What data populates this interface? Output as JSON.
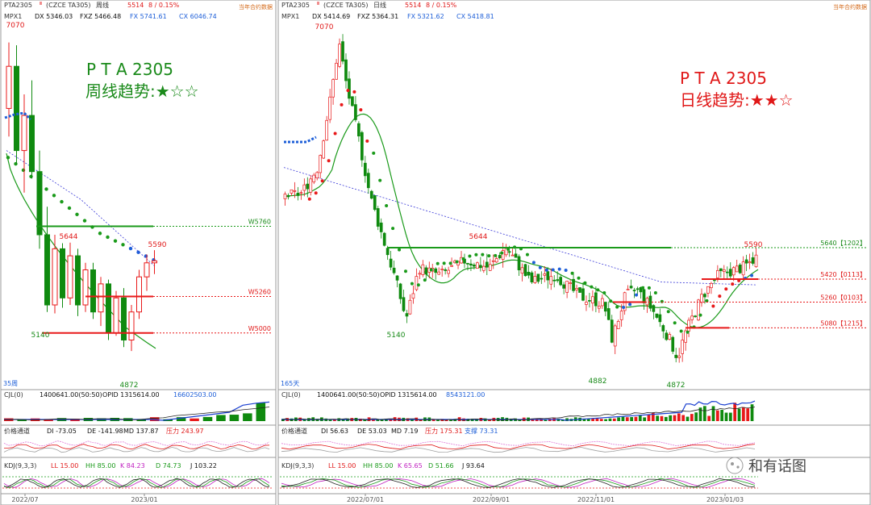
{
  "left": {
    "header": {
      "symbol": "PTA2305",
      "sup": "Ⅲ",
      "contract": "(CZCE TA305)",
      "period": "周线",
      "price": "5514",
      "change": "8 / 0.15%",
      "note": "当年合约数据"
    },
    "indicator_line": {
      "name": "MPX1",
      "dx": "DX 5346.03",
      "fxz": "FXZ 5466.48",
      "fx": "FX 5741.61",
      "cx": "CX 6046.74"
    },
    "watermark": {
      "line1": "P T A  2305",
      "line2": "周线趋势:★☆☆"
    },
    "bars_count_label": "35周",
    "cjl": {
      "name": "CJL(0)",
      "vol": "1400641.00(50:50)",
      "opid": "OPID 1315614.00",
      "extra": "16602503.00"
    },
    "channel": {
      "name": "价格通道",
      "di": "DI -73.05",
      "de": "DE -141.98",
      "md": "MD 137.87",
      "yl": "压力 243.97"
    },
    "kdj": {
      "name": "KDJ(9,3,3)",
      "ll": "LL 15.00",
      "hh": "HH 85.00",
      "k": "K 84.23",
      "d": "D 74.73",
      "j": "J 103.22"
    },
    "x_ticks": [
      "2022/07",
      "2023/01"
    ]
  },
  "right": {
    "header": {
      "symbol": "PTA2305",
      "sup": "Ⅲ",
      "contract": "(CZCE TA305)",
      "period": "日线",
      "price": "5514",
      "change": "8 / 0.15%",
      "note": "当年合约数据"
    },
    "indicator_line": {
      "name": "MPX1",
      "dx": "DX 5414.69",
      "fxz": "FXZ 5364.31",
      "fx": "FX 5321.62",
      "cx": "CX 5418.81"
    },
    "watermark": {
      "line1": "P T A  2305",
      "line2": "日线趋势:★★☆"
    },
    "bars_count_label": "165天",
    "cjl": {
      "name": "CJL(0)",
      "vol": "1400641.00(50:50)",
      "opid": "OPID 1315614.00",
      "extra": "8543121.00"
    },
    "channel": {
      "name": "价格通道",
      "di": "DI 56.63",
      "de": "DE 53.03",
      "md": "MD 7.19",
      "yl": "压力 175.31",
      "zc": "支撑 73.31"
    },
    "kdj": {
      "name": "KDJ(9,3,3)",
      "ll": "LL 15.00",
      "hh": "HH 85.00",
      "k": "K 65.65",
      "d": "D 51.66",
      "j": "J 93.64"
    },
    "x_ticks": [
      "2022/07/01",
      "2022/09/01",
      "2022/11/01",
      "2023/01/03"
    ]
  },
  "brand": {
    "name": "和有话图"
  },
  "colors": {
    "up": "#e8191a",
    "down": "#0f8a0f",
    "blue": "#1e5fd8",
    "green_line": "#1a9a1a",
    "red_line": "#e8191a",
    "label_green": "#188a18",
    "label_red": "#e01818"
  },
  "chart_data": [
    {
      "type": "candlestick",
      "panel": "left-weekly",
      "ylim": [
        4700,
        7200
      ],
      "price_labels": [
        {
          "text": "7070",
          "value": 7070
        },
        {
          "text": "5644",
          "value": 5644
        },
        {
          "text": "5590",
          "value": 5590
        },
        {
          "text": "5140",
          "value": 5140
        },
        {
          "text": "4872",
          "value": 4872
        }
      ],
      "levels": [
        {
          "label": "W5760",
          "value": 5760,
          "color": "green"
        },
        {
          "label": "W5260",
          "value": 5260,
          "color": "red"
        },
        {
          "label": "W5000",
          "value": 5000,
          "color": "red"
        }
      ],
      "candles": [
        [
          6600,
          7070,
          6400,
          6900
        ],
        [
          6900,
          7050,
          6200,
          6300
        ],
        [
          6300,
          6700,
          6000,
          6550
        ],
        [
          6550,
          6800,
          6100,
          6150
        ],
        [
          6150,
          6300,
          5600,
          5700
        ],
        [
          5700,
          5900,
          5150,
          5200
        ],
        [
          5200,
          5700,
          5140,
          5600
        ],
        [
          5600,
          5640,
          5180,
          5250
        ],
        [
          5250,
          5644,
          5200,
          5550
        ],
        [
          5550,
          5600,
          5120,
          5200
        ],
        [
          5200,
          5500,
          5150,
          5450
        ],
        [
          5450,
          5500,
          5100,
          5150
        ],
        [
          5150,
          5400,
          5050,
          5350
        ],
        [
          5350,
          5380,
          4950,
          5000
        ],
        [
          5000,
          5300,
          4980,
          5250
        ],
        [
          5250,
          5320,
          4900,
          4950
        ],
        [
          4950,
          5200,
          4872,
          5150
        ],
        [
          5150,
          5450,
          5100,
          5400
        ],
        [
          5400,
          5560,
          5300,
          5500
        ],
        [
          5500,
          5590,
          5420,
          5514
        ]
      ]
    },
    {
      "type": "candlestick",
      "panel": "right-daily",
      "ylim": [
        4750,
        7200
      ],
      "price_labels": [
        {
          "text": "7070",
          "value": 7070
        },
        {
          "text": "5644",
          "value": 5644
        },
        {
          "text": "5590",
          "value": 5590
        },
        {
          "text": "5140",
          "value": 5140
        },
        {
          "text": "4882",
          "value": 4882
        },
        {
          "text": "4872",
          "value": 4872
        }
      ],
      "levels": [
        {
          "label": "5640【1202】",
          "value": 5640,
          "color": "green"
        },
        {
          "label": "5420【0113】",
          "value": 5420,
          "color": "red"
        },
        {
          "label": "5260【0103】",
          "value": 5260,
          "color": "red"
        },
        {
          "label": "5080【1215】",
          "value": 5080,
          "color": "red"
        }
      ]
    }
  ]
}
